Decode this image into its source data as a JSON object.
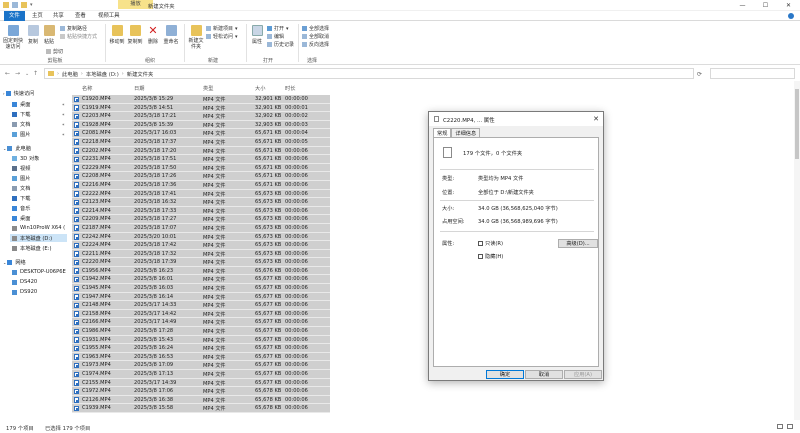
{
  "titlebar": {
    "context_tab": "播放",
    "title": "新建文件夹"
  },
  "tabs": {
    "file": "文件",
    "home": "主页",
    "share": "共享",
    "view": "查看",
    "video_tools": "视频工具"
  },
  "ribbon": {
    "pin": "固定到快速访问",
    "copy": "复制",
    "paste": "粘贴",
    "copy_path": "复制路径",
    "paste_shortcut": "粘贴快捷方式",
    "cut": "剪切",
    "clipboard_group": "剪贴板",
    "move_to": "移动到",
    "copy_to": "复制到",
    "delete": "删除",
    "rename": "重命名",
    "organize_group": "组织",
    "new_folder": "新建文件夹",
    "new_item": "新建项目",
    "easy_access": "轻松访问",
    "new_group": "新建",
    "properties": "属性",
    "open": "打开",
    "edit": "编辑",
    "history": "历史记录",
    "open_group": "打开",
    "select_all": "全部选择",
    "select_none": "全部取消",
    "invert": "反向选择",
    "select_group": "选择"
  },
  "address": {
    "crumbs": [
      "此电脑",
      "本地磁盘 (D:)",
      "新建文件夹"
    ]
  },
  "nav": {
    "items": [
      {
        "label": "快速访问"
      },
      {
        "label": "桌面"
      },
      {
        "label": "下载"
      },
      {
        "label": "文档"
      },
      {
        "label": "图片"
      },
      {
        "label": "此电脑"
      },
      {
        "label": "3D 对象"
      },
      {
        "label": "视频"
      },
      {
        "label": "图片"
      },
      {
        "label": "文档"
      },
      {
        "label": "下载"
      },
      {
        "label": "音乐"
      },
      {
        "label": "桌面"
      },
      {
        "label": "Win10ProW X64 ("
      },
      {
        "label": "本地磁盘 (D:)"
      },
      {
        "label": "本地磁盘 (E:)"
      },
      {
        "label": "网络"
      },
      {
        "label": "DESKTOP-U06P6E"
      },
      {
        "label": "DS420"
      },
      {
        "label": "DS920"
      }
    ]
  },
  "columns": {
    "name": "名称",
    "date": "日期",
    "type": "类型",
    "size": "大小",
    "length": "时长"
  },
  "files": [
    {
      "name": "C1920.MP4",
      "date": "2025/3/8 15:29",
      "type": "MP4 文件",
      "size": "32,901 KB",
      "len": "00:00:00"
    },
    {
      "name": "C1919.MP4",
      "date": "2025/3/8 14:51",
      "type": "MP4 文件",
      "size": "32,901 KB",
      "len": "00:00:01"
    },
    {
      "name": "C2203.MP4",
      "date": "2025/3/18 17:21",
      "type": "MP4 文件",
      "size": "32,902 KB",
      "len": "00:00:02"
    },
    {
      "name": "C1928.MP4",
      "date": "2025/3/8 15:39",
      "type": "MP4 文件",
      "size": "32,903 KB",
      "len": "00:00:03"
    },
    {
      "name": "C2081.MP4",
      "date": "2025/3/17 16:03",
      "type": "MP4 文件",
      "size": "65,671 KB",
      "len": "00:00:04"
    },
    {
      "name": "C2218.MP4",
      "date": "2025/3/18 17:37",
      "type": "MP4 文件",
      "size": "65,671 KB",
      "len": "00:00:05"
    },
    {
      "name": "C2202.MP4",
      "date": "2025/3/18 17:20",
      "type": "MP4 文件",
      "size": "65,671 KB",
      "len": "00:00:06"
    },
    {
      "name": "C2231.MP4",
      "date": "2025/3/18 17:51",
      "type": "MP4 文件",
      "size": "65,671 KB",
      "len": "00:00:06"
    },
    {
      "name": "C2229.MP4",
      "date": "2025/3/18 17:50",
      "type": "MP4 文件",
      "size": "65,671 KB",
      "len": "00:00:06"
    },
    {
      "name": "C2208.MP4",
      "date": "2025/3/18 17:26",
      "type": "MP4 文件",
      "size": "65,671 KB",
      "len": "00:00:06"
    },
    {
      "name": "C2216.MP4",
      "date": "2025/3/18 17:36",
      "type": "MP4 文件",
      "size": "65,671 KB",
      "len": "00:00:06"
    },
    {
      "name": "C2222.MP4",
      "date": "2025/3/18 17:41",
      "type": "MP4 文件",
      "size": "65,673 KB",
      "len": "00:00:06"
    },
    {
      "name": "C2123.MP4",
      "date": "2025/3/18 16:32",
      "type": "MP4 文件",
      "size": "65,673 KB",
      "len": "00:00:06"
    },
    {
      "name": "C2214.MP4",
      "date": "2025/3/18 17:33",
      "type": "MP4 文件",
      "size": "65,673 KB",
      "len": "00:00:06"
    },
    {
      "name": "C2209.MP4",
      "date": "2025/3/18 17:27",
      "type": "MP4 文件",
      "size": "65,673 KB",
      "len": "00:00:06"
    },
    {
      "name": "C2187.MP4",
      "date": "2025/3/18 17:07",
      "type": "MP4 文件",
      "size": "65,673 KB",
      "len": "00:00:06"
    },
    {
      "name": "C2242.MP4",
      "date": "2025/3/20 10:01",
      "type": "MP4 文件",
      "size": "65,673 KB",
      "len": "00:00:06"
    },
    {
      "name": "C2224.MP4",
      "date": "2025/3/18 17:42",
      "type": "MP4 文件",
      "size": "65,673 KB",
      "len": "00:00:06"
    },
    {
      "name": "C2211.MP4",
      "date": "2025/3/18 17:32",
      "type": "MP4 文件",
      "size": "65,673 KB",
      "len": "00:00:06"
    },
    {
      "name": "C2220.MP4",
      "date": "2025/3/18 17:39",
      "type": "MP4 文件",
      "size": "65,673 KB",
      "len": "00:00:06"
    },
    {
      "name": "C1956.MP4",
      "date": "2025/3/8 16:23",
      "type": "MP4 文件",
      "size": "65,676 KB",
      "len": "00:00:06"
    },
    {
      "name": "C1942.MP4",
      "date": "2025/3/8 16:01",
      "type": "MP4 文件",
      "size": "65,677 KB",
      "len": "00:00:06"
    },
    {
      "name": "C1945.MP4",
      "date": "2025/3/8 16:03",
      "type": "MP4 文件",
      "size": "65,677 KB",
      "len": "00:00:06"
    },
    {
      "name": "C1947.MP4",
      "date": "2025/3/8 16:14",
      "type": "MP4 文件",
      "size": "65,677 KB",
      "len": "00:00:06"
    },
    {
      "name": "C2148.MP4",
      "date": "2025/3/17 14:33",
      "type": "MP4 文件",
      "size": "65,677 KB",
      "len": "00:00:06"
    },
    {
      "name": "C2158.MP4",
      "date": "2025/3/17 14:42",
      "type": "MP4 文件",
      "size": "65,677 KB",
      "len": "00:00:06"
    },
    {
      "name": "C2166.MP4",
      "date": "2025/3/17 14:49",
      "type": "MP4 文件",
      "size": "65,677 KB",
      "len": "00:00:06"
    },
    {
      "name": "C1986.MP4",
      "date": "2025/3/8 17:28",
      "type": "MP4 文件",
      "size": "65,677 KB",
      "len": "00:00:06"
    },
    {
      "name": "C1931.MP4",
      "date": "2025/3/8 15:43",
      "type": "MP4 文件",
      "size": "65,677 KB",
      "len": "00:00:06"
    },
    {
      "name": "C1955.MP4",
      "date": "2025/3/8 16:24",
      "type": "MP4 文件",
      "size": "65,677 KB",
      "len": "00:00:06"
    },
    {
      "name": "C1963.MP4",
      "date": "2025/3/8 16:53",
      "type": "MP4 文件",
      "size": "65,677 KB",
      "len": "00:00:06"
    },
    {
      "name": "C1973.MP4",
      "date": "2025/3/8 17:09",
      "type": "MP4 文件",
      "size": "65,677 KB",
      "len": "00:00:06"
    },
    {
      "name": "C1974.MP4",
      "date": "2025/3/8 17:13",
      "type": "MP4 文件",
      "size": "65,677 KB",
      "len": "00:00:06"
    },
    {
      "name": "C2155.MP4",
      "date": "2025/3/17 14:39",
      "type": "MP4 文件",
      "size": "65,677 KB",
      "len": "00:00:06"
    },
    {
      "name": "C1972.MP4",
      "date": "2025/3/8 17:06",
      "type": "MP4 文件",
      "size": "65,678 KB",
      "len": "00:00:06"
    },
    {
      "name": "C2126.MP4",
      "date": "2025/3/8 16:38",
      "type": "MP4 文件",
      "size": "65,678 KB",
      "len": "00:00:06"
    },
    {
      "name": "C1939.MP4",
      "date": "2025/3/8 15:58",
      "type": "MP4 文件",
      "size": "65,678 KB",
      "len": "00:00:06"
    }
  ],
  "status": {
    "count": "179 个项目",
    "selected": "已选择 179 个项目"
  },
  "dialog": {
    "title": "C2220.MP4, ... 属性",
    "tab_general": "常规",
    "tab_details": "详细信息",
    "summary": "179 个文件，0 个文件夹",
    "type_label": "类型:",
    "type_value": "类型均为 MP4 文件",
    "location_label": "位置:",
    "location_value": "全部位于 D:\\新建文件夹",
    "size_label": "大小:",
    "size_value": "34.0 GB (36,568,625,040 字节)",
    "disk_label": "占用空间:",
    "disk_value": "34.0 GB (36,568,989,696 字节)",
    "attr_label": "属性:",
    "readonly": "只读(R)",
    "hidden": "隐藏(H)",
    "advanced": "高级(D)...",
    "ok": "确定",
    "cancel": "取消",
    "apply": "应用(A)"
  }
}
